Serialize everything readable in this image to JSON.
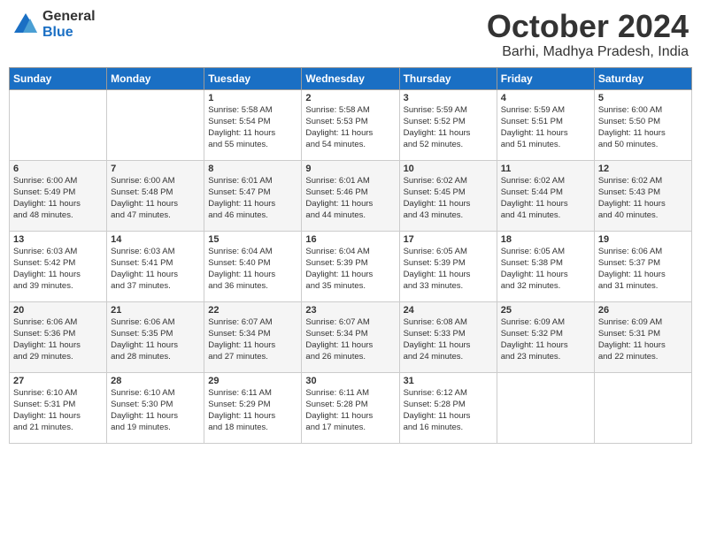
{
  "logo": {
    "general": "General",
    "blue": "Blue"
  },
  "title": "October 2024",
  "location": "Barhi, Madhya Pradesh, India",
  "headers": [
    "Sunday",
    "Monday",
    "Tuesday",
    "Wednesday",
    "Thursday",
    "Friday",
    "Saturday"
  ],
  "weeks": [
    [
      {
        "day": "",
        "lines": []
      },
      {
        "day": "",
        "lines": []
      },
      {
        "day": "1",
        "lines": [
          "Sunrise: 5:58 AM",
          "Sunset: 5:54 PM",
          "Daylight: 11 hours",
          "and 55 minutes."
        ]
      },
      {
        "day": "2",
        "lines": [
          "Sunrise: 5:58 AM",
          "Sunset: 5:53 PM",
          "Daylight: 11 hours",
          "and 54 minutes."
        ]
      },
      {
        "day": "3",
        "lines": [
          "Sunrise: 5:59 AM",
          "Sunset: 5:52 PM",
          "Daylight: 11 hours",
          "and 52 minutes."
        ]
      },
      {
        "day": "4",
        "lines": [
          "Sunrise: 5:59 AM",
          "Sunset: 5:51 PM",
          "Daylight: 11 hours",
          "and 51 minutes."
        ]
      },
      {
        "day": "5",
        "lines": [
          "Sunrise: 6:00 AM",
          "Sunset: 5:50 PM",
          "Daylight: 11 hours",
          "and 50 minutes."
        ]
      }
    ],
    [
      {
        "day": "6",
        "lines": [
          "Sunrise: 6:00 AM",
          "Sunset: 5:49 PM",
          "Daylight: 11 hours",
          "and 48 minutes."
        ]
      },
      {
        "day": "7",
        "lines": [
          "Sunrise: 6:00 AM",
          "Sunset: 5:48 PM",
          "Daylight: 11 hours",
          "and 47 minutes."
        ]
      },
      {
        "day": "8",
        "lines": [
          "Sunrise: 6:01 AM",
          "Sunset: 5:47 PM",
          "Daylight: 11 hours",
          "and 46 minutes."
        ]
      },
      {
        "day": "9",
        "lines": [
          "Sunrise: 6:01 AM",
          "Sunset: 5:46 PM",
          "Daylight: 11 hours",
          "and 44 minutes."
        ]
      },
      {
        "day": "10",
        "lines": [
          "Sunrise: 6:02 AM",
          "Sunset: 5:45 PM",
          "Daylight: 11 hours",
          "and 43 minutes."
        ]
      },
      {
        "day": "11",
        "lines": [
          "Sunrise: 6:02 AM",
          "Sunset: 5:44 PM",
          "Daylight: 11 hours",
          "and 41 minutes."
        ]
      },
      {
        "day": "12",
        "lines": [
          "Sunrise: 6:02 AM",
          "Sunset: 5:43 PM",
          "Daylight: 11 hours",
          "and 40 minutes."
        ]
      }
    ],
    [
      {
        "day": "13",
        "lines": [
          "Sunrise: 6:03 AM",
          "Sunset: 5:42 PM",
          "Daylight: 11 hours",
          "and 39 minutes."
        ]
      },
      {
        "day": "14",
        "lines": [
          "Sunrise: 6:03 AM",
          "Sunset: 5:41 PM",
          "Daylight: 11 hours",
          "and 37 minutes."
        ]
      },
      {
        "day": "15",
        "lines": [
          "Sunrise: 6:04 AM",
          "Sunset: 5:40 PM",
          "Daylight: 11 hours",
          "and 36 minutes."
        ]
      },
      {
        "day": "16",
        "lines": [
          "Sunrise: 6:04 AM",
          "Sunset: 5:39 PM",
          "Daylight: 11 hours",
          "and 35 minutes."
        ]
      },
      {
        "day": "17",
        "lines": [
          "Sunrise: 6:05 AM",
          "Sunset: 5:39 PM",
          "Daylight: 11 hours",
          "and 33 minutes."
        ]
      },
      {
        "day": "18",
        "lines": [
          "Sunrise: 6:05 AM",
          "Sunset: 5:38 PM",
          "Daylight: 11 hours",
          "and 32 minutes."
        ]
      },
      {
        "day": "19",
        "lines": [
          "Sunrise: 6:06 AM",
          "Sunset: 5:37 PM",
          "Daylight: 11 hours",
          "and 31 minutes."
        ]
      }
    ],
    [
      {
        "day": "20",
        "lines": [
          "Sunrise: 6:06 AM",
          "Sunset: 5:36 PM",
          "Daylight: 11 hours",
          "and 29 minutes."
        ]
      },
      {
        "day": "21",
        "lines": [
          "Sunrise: 6:06 AM",
          "Sunset: 5:35 PM",
          "Daylight: 11 hours",
          "and 28 minutes."
        ]
      },
      {
        "day": "22",
        "lines": [
          "Sunrise: 6:07 AM",
          "Sunset: 5:34 PM",
          "Daylight: 11 hours",
          "and 27 minutes."
        ]
      },
      {
        "day": "23",
        "lines": [
          "Sunrise: 6:07 AM",
          "Sunset: 5:34 PM",
          "Daylight: 11 hours",
          "and 26 minutes."
        ]
      },
      {
        "day": "24",
        "lines": [
          "Sunrise: 6:08 AM",
          "Sunset: 5:33 PM",
          "Daylight: 11 hours",
          "and 24 minutes."
        ]
      },
      {
        "day": "25",
        "lines": [
          "Sunrise: 6:09 AM",
          "Sunset: 5:32 PM",
          "Daylight: 11 hours",
          "and 23 minutes."
        ]
      },
      {
        "day": "26",
        "lines": [
          "Sunrise: 6:09 AM",
          "Sunset: 5:31 PM",
          "Daylight: 11 hours",
          "and 22 minutes."
        ]
      }
    ],
    [
      {
        "day": "27",
        "lines": [
          "Sunrise: 6:10 AM",
          "Sunset: 5:31 PM",
          "Daylight: 11 hours",
          "and 21 minutes."
        ]
      },
      {
        "day": "28",
        "lines": [
          "Sunrise: 6:10 AM",
          "Sunset: 5:30 PM",
          "Daylight: 11 hours",
          "and 19 minutes."
        ]
      },
      {
        "day": "29",
        "lines": [
          "Sunrise: 6:11 AM",
          "Sunset: 5:29 PM",
          "Daylight: 11 hours",
          "and 18 minutes."
        ]
      },
      {
        "day": "30",
        "lines": [
          "Sunrise: 6:11 AM",
          "Sunset: 5:28 PM",
          "Daylight: 11 hours",
          "and 17 minutes."
        ]
      },
      {
        "day": "31",
        "lines": [
          "Sunrise: 6:12 AM",
          "Sunset: 5:28 PM",
          "Daylight: 11 hours",
          "and 16 minutes."
        ]
      },
      {
        "day": "",
        "lines": []
      },
      {
        "day": "",
        "lines": []
      }
    ]
  ]
}
